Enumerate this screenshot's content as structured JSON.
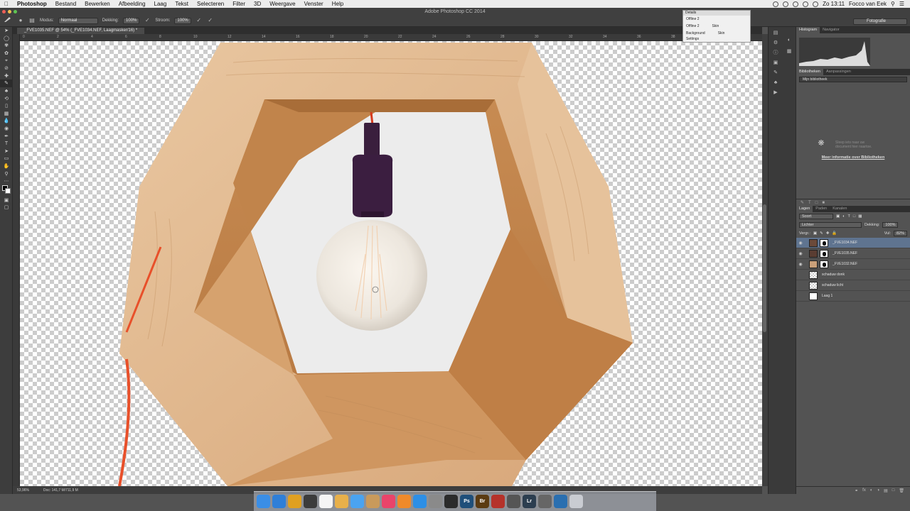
{
  "menubar": {
    "items": [
      "Photoshop",
      "Bestand",
      "Bewerken",
      "Afbeelding",
      "Laag",
      "Tekst",
      "Selecteren",
      "Filter",
      "3D",
      "Weergave",
      "Venster",
      "Help"
    ],
    "clock": "Zo 13:11",
    "user": "Focco van Eek"
  },
  "window": {
    "title": "Adobe Photoshop CC 2014"
  },
  "options": {
    "mode_label": "Modus:",
    "mode_value": "Normaal",
    "opacity_label": "Dekking:",
    "opacity_value": "100%",
    "flow_label": "Stroom:",
    "flow_value": "100%",
    "workspace": "Fotografie"
  },
  "document": {
    "tab": "_FVE1035.NEF @ 54% (_FVE1034.NEF, Laagmasker/16) *",
    "zoom": "53,96%",
    "doc_size": "Doc: 141,7 M/711,9 M"
  },
  "ruler_ticks": [
    "0",
    "2",
    "4",
    "6",
    "8",
    "10",
    "12",
    "14",
    "16",
    "18",
    "20",
    "22",
    "24",
    "26",
    "28",
    "30",
    "32",
    "34",
    "36",
    "38",
    "40",
    "42"
  ],
  "properties_panel": {
    "title": "Details",
    "rows": [
      {
        "a": "Offline 2",
        "b": ""
      },
      {
        "a": "Offline 2",
        "b": "Skin"
      },
      {
        "a": "Background",
        "b": "Skin"
      },
      {
        "a": "Settings",
        "b": ""
      }
    ]
  },
  "right_panels": {
    "top_tabs": [
      "Histogram",
      "Navigator"
    ],
    "library_tabs": [
      "Bibliotheken",
      "Aanpassingen"
    ],
    "library_select": "Mijn bibliotheek",
    "library_message": "Sleep iets naar uw document hier naartoe.",
    "library_link": "Meer informatie over Bibliotheken",
    "layers_tabs": [
      "Lagen",
      "Paden",
      "Kanalen"
    ],
    "filter_label": "Soort",
    "blend_mode": "Lichter",
    "opacity_label": "Dekking:",
    "opacity_value": "100%",
    "lock_label": "Vergr.:",
    "fill_label": "Vul:",
    "fill_value": "82%",
    "layers": [
      {
        "name": "_FVE1034.NEF",
        "active": true,
        "visible": true,
        "mask": true,
        "thumb": "#6b4a3a"
      },
      {
        "name": "_FVE1035.NEF",
        "active": false,
        "visible": true,
        "mask": true,
        "thumb": "#5a3d32"
      },
      {
        "name": "_FVE1032.NEF",
        "active": false,
        "visible": true,
        "mask": true,
        "thumb": "#c9a07a"
      },
      {
        "name": "schaduw donk",
        "active": false,
        "visible": false,
        "mask": false,
        "thumb": "checker"
      },
      {
        "name": "schaduw licht",
        "active": false,
        "visible": false,
        "mask": false,
        "thumb": "checker"
      },
      {
        "name": "Laag 1",
        "active": false,
        "visible": false,
        "mask": false,
        "thumb": "#ffffff"
      }
    ]
  },
  "dock_apps": [
    {
      "icon": "finder-icon",
      "color": "#3a8ee6",
      "glyph": ""
    },
    {
      "icon": "safari-icon",
      "color": "#2f7fd8",
      "glyph": ""
    },
    {
      "icon": "chrome-icon",
      "color": "#e0a021",
      "glyph": ""
    },
    {
      "icon": "mission-control-icon",
      "color": "#3c3c3c",
      "glyph": ""
    },
    {
      "icon": "calendar-icon",
      "color": "#f5f5f5",
      "glyph": ""
    },
    {
      "icon": "photos-icon",
      "color": "#e8b04a",
      "glyph": ""
    },
    {
      "icon": "messages-icon",
      "color": "#4aa3f0",
      "glyph": ""
    },
    {
      "icon": "contacts-icon",
      "color": "#c99a5b",
      "glyph": ""
    },
    {
      "icon": "itunes-icon",
      "color": "#e9446a",
      "glyph": ""
    },
    {
      "icon": "ibooks-icon",
      "color": "#f08a2a",
      "glyph": ""
    },
    {
      "icon": "app-store-icon",
      "color": "#2d8fe6",
      "glyph": ""
    },
    {
      "icon": "preferences-icon",
      "color": "#8a8a8a",
      "glyph": ""
    },
    {
      "icon": "folder-icon",
      "color": "#2b2b2b",
      "glyph": ""
    },
    {
      "icon": "photoshop-icon",
      "color": "#1f4f7a",
      "glyph": "Ps"
    },
    {
      "icon": "bridge-icon",
      "color": "#5b3b12",
      "glyph": "Br"
    },
    {
      "icon": "acrobat-icon",
      "color": "#b5322a",
      "glyph": ""
    },
    {
      "icon": "utility-icon",
      "color": "#555555",
      "glyph": ""
    },
    {
      "icon": "lightroom-icon",
      "color": "#2c3e50",
      "glyph": "Lr"
    },
    {
      "icon": "tool-icon",
      "color": "#666666",
      "glyph": ""
    },
    {
      "icon": "network-icon",
      "color": "#2a6fb0",
      "glyph": ""
    },
    {
      "icon": "trash-icon",
      "color": "#c9ccd2",
      "glyph": ""
    }
  ]
}
